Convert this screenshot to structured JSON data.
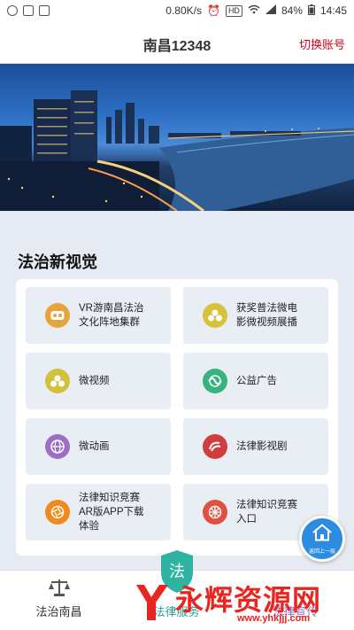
{
  "status_bar": {
    "speed": "0.80K/s",
    "hd": "HD",
    "battery": "84%",
    "time": "14:45"
  },
  "header": {
    "title": "南昌12348",
    "switch_account": "切换账号"
  },
  "section": {
    "title": "法治新视觉"
  },
  "cards": [
    {
      "label": "VR游南昌法治\n文化阵地集群",
      "icon": "vr-goggles-icon",
      "color": "#e6a43a"
    },
    {
      "label": "获奖普法微电\n影微视频展播",
      "icon": "award-coins-icon",
      "color": "#d7c23a"
    },
    {
      "label": "微视频",
      "icon": "micro-video-icon",
      "color": "#d3c03b"
    },
    {
      "label": "公益广告",
      "icon": "public-ad-icon",
      "color": "#36b37e"
    },
    {
      "label": "微动画",
      "icon": "globe-icon",
      "color": "#9a6fc4"
    },
    {
      "label": "法律影视剧",
      "icon": "film-reel-icon",
      "color": "#d13c3c"
    },
    {
      "label": "法律知识竞赛\nAR版APP下载\n体验",
      "icon": "aperture-icon",
      "color": "#f08a1c"
    },
    {
      "label": "法律知识竞赛\n入口",
      "icon": "wheel-icon",
      "color": "#e05040"
    }
  ],
  "float_button": {
    "label": "返回上一层"
  },
  "tabbar": {
    "tab1": "法治南昌",
    "tab2": "法律服务",
    "tab3": "法律宣传"
  },
  "watermark": {
    "text": "永辉资源网",
    "url": "www.yhkjjj.com"
  }
}
